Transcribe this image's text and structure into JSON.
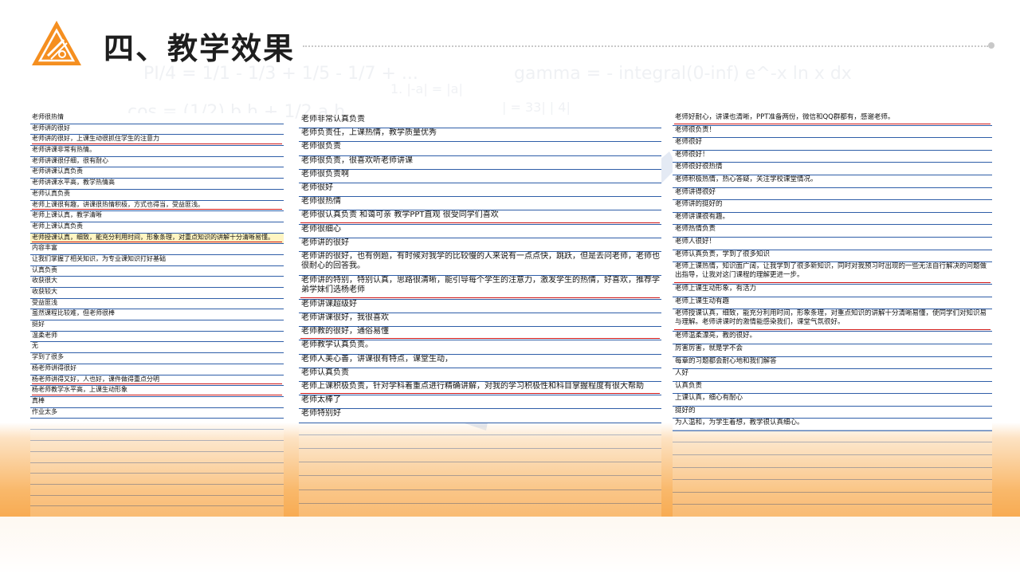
{
  "title": "四、教学效果",
  "formulas": [
    "PI/4 = 1/1 - 1/3 + 1/5 - 1/7 + ...",
    "gamma = - integral(0-inf) e^-x ln x dx",
    "1. |-a| = |a|",
    "cos = (1/2) b h + 1/2 a h",
    "| = 33| | 4|"
  ],
  "colors": {
    "accent": "#f58f20",
    "line": "#2f5ea8",
    "underline": "#d01818",
    "highlight": "#fff5c2"
  },
  "col1": [
    {
      "text": "老师很热情"
    },
    {
      "text": "老师讲的很好"
    },
    {
      "text": "老师讲的很好，上课生动很抓住学生的注意力",
      "ul": true
    },
    {
      "text": "老师讲课非常有热情。"
    },
    {
      "text": "老师讲课很仔细，很有耐心"
    },
    {
      "text": "老师讲课认真负责"
    },
    {
      "text": "老师讲课水平高，教学热情高"
    },
    {
      "text": "老师认真负责"
    },
    {
      "text": "老师上课很有趣，讲课很热情积极，方式也得当，受益匪浅。",
      "ul": true
    },
    {
      "text": "老师上课认真，教学清晰"
    },
    {
      "text": "老师上课认真负责"
    },
    {
      "text": "老师授课认真，细致，能充分利用时间，形象条理，对重点知识的讲解十分清晰易懂。",
      "ul": true,
      "hl": true
    },
    {
      "text": "内容丰富"
    },
    {
      "text": "让我们掌握了相关知识，为专业课知识打好基础"
    },
    {
      "text": "认真负责"
    },
    {
      "text": "收获很大"
    },
    {
      "text": "收获较大"
    },
    {
      "text": "受益匪浅"
    },
    {
      "text": "虽然课程比较难，但老师很棒"
    },
    {
      "text": "挺好"
    },
    {
      "text": "温柔老师"
    },
    {
      "text": "无"
    },
    {
      "text": "学到了很多"
    },
    {
      "text": "杨老师讲得很好"
    },
    {
      "text": "杨老师讲得又好，人也好，课件做得重点分明",
      "ul": true
    },
    {
      "text": "杨老师教学水平高，上课生动形象",
      "ul": true
    },
    {
      "text": "真棒"
    },
    {
      "text": "作业太多"
    }
  ],
  "col2": [
    {
      "text": "老师非常认真负责"
    },
    {
      "text": "老师负责任，上课热情，教学质量优秀"
    },
    {
      "text": "老师很负责"
    },
    {
      "text": "老师很负责，很喜欢听老师讲课"
    },
    {
      "text": "老师很负责啊"
    },
    {
      "text": "老师很好"
    },
    {
      "text": "老师很热情"
    },
    {
      "text": "老师很认真负责 和蔼可亲 教学PPT直观 很受同学们喜欢",
      "ul": true
    },
    {
      "text": "老师很细心"
    },
    {
      "text": "老师讲的很好"
    },
    {
      "text": "老师讲的很好，也有例题，有时候对我学的比较慢的人来说有一点点快，跳跃，但是去问老师，老师也很耐心的回答我。",
      "tall": true
    },
    {
      "text": "老师讲的特别，特别认真，思路很清晰，能引导每个学生的注意力，激发学生的热情，好喜欢，推荐学弟学妹们选杨老师",
      "tall": true,
      "ul": true
    },
    {
      "text": "老师讲课超级好"
    },
    {
      "text": "老师讲课很好，我很喜欢"
    },
    {
      "text": "老师教的很好，通俗易懂",
      "ul": true
    },
    {
      "text": "老师教学认真负责。"
    },
    {
      "text": "老师人美心善，讲课很有特点，课堂生动，"
    },
    {
      "text": "老师认真负责"
    },
    {
      "text": "老师上课积极负责，针对学科着重点进行精确讲解，对我的学习积极性和科目掌握程度有很大帮助",
      "ul": true
    },
    {
      "text": "老师太棒了"
    },
    {
      "text": "老师特别好"
    }
  ],
  "col3": [
    {
      "text": "老师好耐心，讲课也清晰，PPT准备两份，微信和QQ群都有，感谢老师。",
      "ul": true
    },
    {
      "text": "老师很负责！"
    },
    {
      "text": "老师很好"
    },
    {
      "text": "老师很好！"
    },
    {
      "text": "老师很好很热情"
    },
    {
      "text": "老师积极热情，热心答疑，关注学校课堂情况。"
    },
    {
      "text": "老师讲得很好"
    },
    {
      "text": "老师讲的挺好的"
    },
    {
      "text": "老师讲课很有趣。"
    },
    {
      "text": "老师热情负责"
    },
    {
      "text": "老师人很好！"
    },
    {
      "text": "老师认真负责，学到了很多知识"
    },
    {
      "text": "老师上课热情，知识面广阔，让我学到了很多新知识，同时对我预习时出现的一些无法自行解决的问题做出指导，让我对这门课程的理解更进一步。",
      "tall": true,
      "ul": true
    },
    {
      "text": "老师上课生动形象，有活力"
    },
    {
      "text": "老师上课生动有趣"
    },
    {
      "text": "老师授课认真，细致，能充分利用时间，形象条理，对重点知识的讲解十分清晰易懂，使同学们对知识易与理解。老师讲课时的激情能感染我们，课堂气氛很好。",
      "tall": true,
      "ul": true
    },
    {
      "text": "老师温柔漂亮，教的很好。"
    },
    {
      "text": "厉害厉害，就是学不会"
    },
    {
      "text": "每章的习题都会耐心地和我们解答"
    },
    {
      "text": "人好"
    },
    {
      "text": "认真负责"
    },
    {
      "text": "上课认真，细心有耐心"
    },
    {
      "text": "挺好的"
    },
    {
      "text": "为人温和，为学生着想，教学很认真细心。"
    }
  ]
}
